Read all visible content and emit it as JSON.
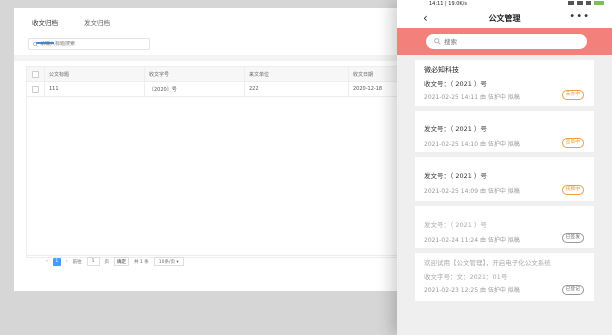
{
  "desktop": {
    "tabs": [
      {
        "label": "收文归档"
      },
      {
        "label": "发文归档"
      }
    ],
    "search_placeholder": "请输入标题搜索",
    "table": {
      "headers": [
        "公文标题",
        "收文字号",
        "来文单位",
        "收文日期"
      ],
      "rows": [
        {
          "title": "111",
          "number": "〔2020〕号",
          "unit": "222",
          "date": "2020-12-18"
        }
      ]
    },
    "pager": {
      "prev": "‹",
      "page": "1",
      "next": "›",
      "goto_label": "前往",
      "goto_value": "1",
      "page_unit": "页",
      "confirm": "确定",
      "total": "共 1 条",
      "page_size": "10条/页 ▾"
    }
  },
  "phone": {
    "status_time": "14:11 | 19.0K/s",
    "title": "公文管理",
    "back_symbol": "‹",
    "more_symbol": "•••",
    "search_placeholder": "搜索",
    "accent_color": "#f3807b",
    "cards": [
      {
        "head": "微必知科技",
        "sub": "收文号：（ 2021 ）号",
        "meta": "2021-02-25 14:11 由 伍护中 拟稿",
        "badge": "未办中",
        "badge_color": "#e8a04a",
        "dim": false
      },
      {
        "head": "",
        "sub": "发文号：（ 2021 ）号",
        "meta": "2021-02-25 14:10 由 伍护中 拟稿",
        "badge": "签章中",
        "badge_color": "#e8a04a",
        "dim": false
      },
      {
        "head": "",
        "sub": "发文号：（ 2021 ）号",
        "meta": "2021-02-25 14:09 由 伍护中 拟稿",
        "badge": "核稿中",
        "badge_color": "#e8a04a",
        "dim": false
      },
      {
        "head": "",
        "sub": "发文号：（ 2021 ）号",
        "meta": "2021-02-24 11:24 由 伍护中 拟稿",
        "badge": "已签发",
        "badge_color": "#666666",
        "dim": true
      },
      {
        "head": "欢迎试用【公文管理】，开启电子化公文系统",
        "sub": "收文字号：文：2021：01号",
        "meta": "2021-02-23 12:25 由 伍护中 拟稿",
        "badge": "已登记",
        "badge_color": "#666666",
        "dim": true
      }
    ]
  }
}
